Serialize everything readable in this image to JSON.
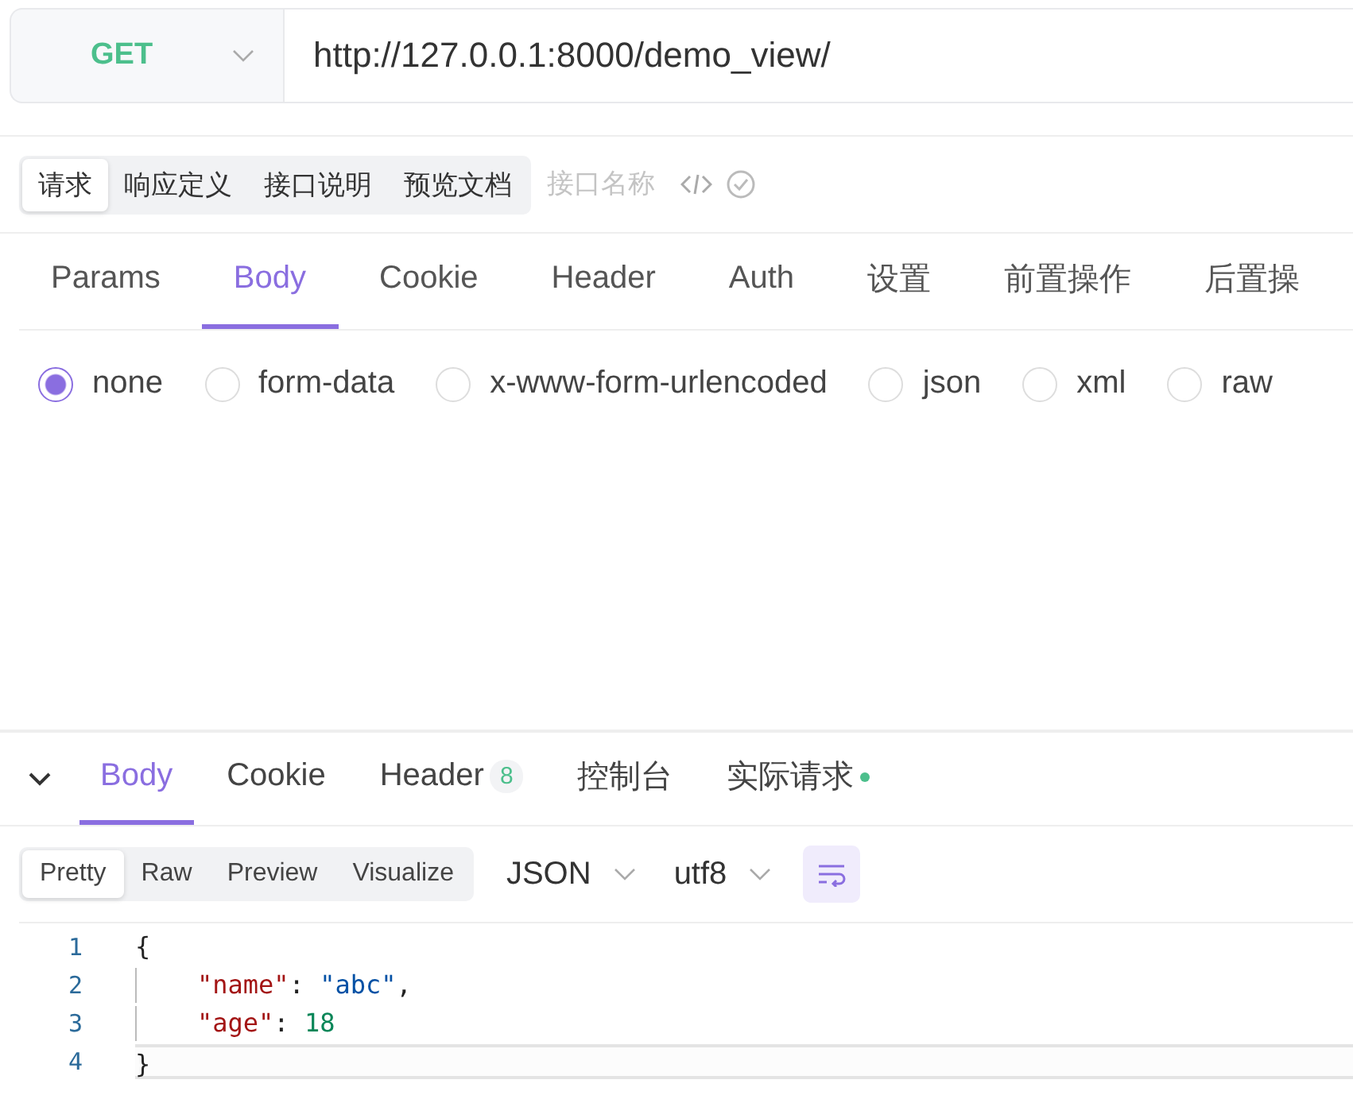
{
  "request_bar": {
    "method": "GET",
    "url": "http://127.0.0.1:8000/demo_view/"
  },
  "mode_tabs": [
    {
      "label": "请求",
      "selected": true
    },
    {
      "label": "响应定义",
      "selected": false
    },
    {
      "label": "接口说明",
      "selected": false
    },
    {
      "label": "预览文档",
      "selected": false
    }
  ],
  "name_field": {
    "placeholder": "接口名称"
  },
  "request_tabs": [
    {
      "label": "Params",
      "selected": false
    },
    {
      "label": "Body",
      "selected": true
    },
    {
      "label": "Cookie",
      "selected": false
    },
    {
      "label": "Header",
      "selected": false
    },
    {
      "label": "Auth",
      "selected": false
    },
    {
      "label": "设置",
      "selected": false
    },
    {
      "label": "前置操作",
      "selected": false
    },
    {
      "label": "后置操",
      "selected": false
    }
  ],
  "body_types": [
    {
      "label": "none",
      "selected": true
    },
    {
      "label": "form-data",
      "selected": false
    },
    {
      "label": "x-www-form-urlencoded",
      "selected": false
    },
    {
      "label": "json",
      "selected": false
    },
    {
      "label": "xml",
      "selected": false
    },
    {
      "label": "raw",
      "selected": false
    }
  ],
  "response_tabs": [
    {
      "label": "Body",
      "selected": true
    },
    {
      "label": "Cookie",
      "selected": false
    },
    {
      "label": "Header",
      "selected": false,
      "badge": "8"
    },
    {
      "label": "控制台",
      "selected": false
    },
    {
      "label": "实际请求",
      "selected": false,
      "dot": true
    }
  ],
  "view_tabs": [
    {
      "label": "Pretty",
      "selected": true
    },
    {
      "label": "Raw",
      "selected": false
    },
    {
      "label": "Preview",
      "selected": false
    },
    {
      "label": "Visualize",
      "selected": false
    }
  ],
  "format": "JSON",
  "encoding": "utf8",
  "code_lines": [
    {
      "number": "1",
      "indented": false,
      "selected": false,
      "tokens": [
        {
          "kind": "punct",
          "text": "{"
        }
      ]
    },
    {
      "number": "2",
      "indented": true,
      "selected": false,
      "tokens": [
        {
          "kind": "key",
          "text": "\"name\""
        },
        {
          "kind": "punct",
          "text": ": "
        },
        {
          "kind": "string",
          "text": "\"abc\""
        },
        {
          "kind": "punct",
          "text": ","
        }
      ]
    },
    {
      "number": "3",
      "indented": true,
      "selected": false,
      "tokens": [
        {
          "kind": "key",
          "text": "\"age\""
        },
        {
          "kind": "punct",
          "text": ": "
        },
        {
          "kind": "number",
          "text": "18"
        }
      ]
    },
    {
      "number": "4",
      "indented": false,
      "selected": true,
      "tokens": [
        {
          "kind": "punct",
          "text": "}"
        }
      ]
    }
  ]
}
